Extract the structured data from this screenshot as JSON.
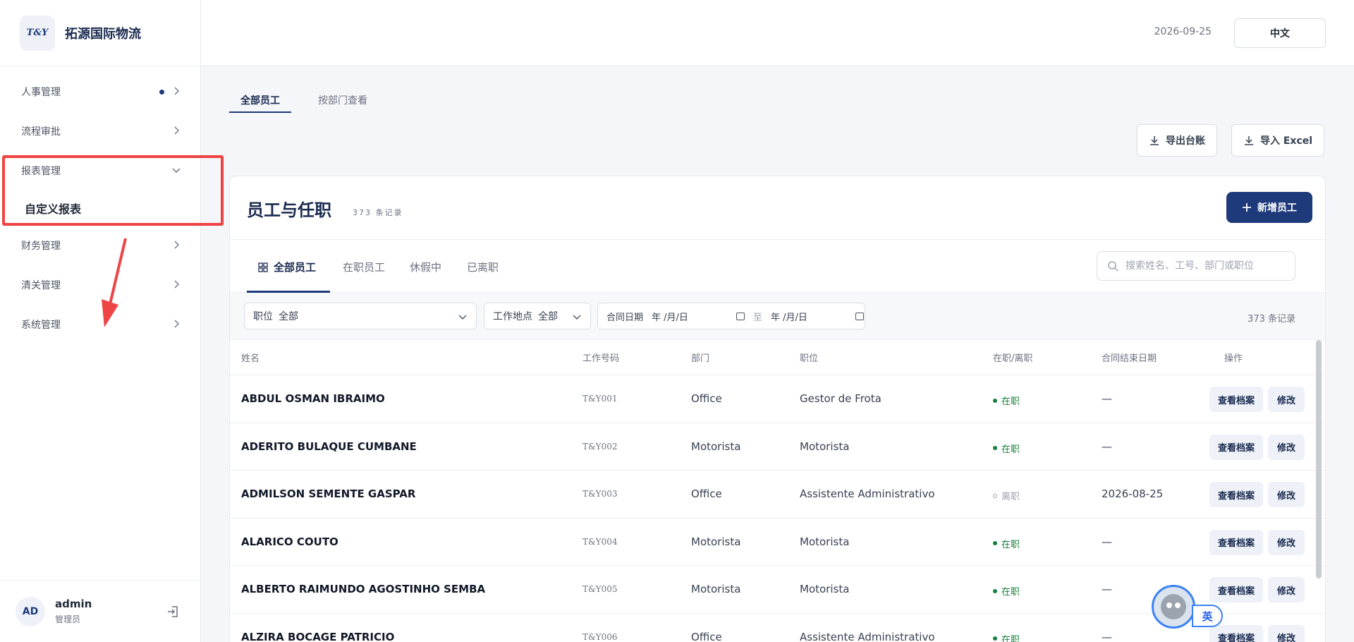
{
  "brand": {
    "logo_text": "T&Y",
    "name": "拓源国际物流"
  },
  "sidebar": {
    "items": [
      {
        "label": "人事管理",
        "has_dot": true,
        "expanded": false
      },
      {
        "label": "流程审批",
        "has_dot": false,
        "expanded": false
      },
      {
        "label": "报表管理",
        "has_dot": false,
        "expanded": true,
        "children": [
          {
            "label": "自定义报表"
          }
        ]
      },
      {
        "label": "财务管理",
        "has_dot": false,
        "expanded": false
      },
      {
        "label": "清关管理",
        "has_dot": false,
        "expanded": false
      },
      {
        "label": "系统管理",
        "has_dot": false,
        "expanded": false
      }
    ],
    "annotation_color": "#ef4444"
  },
  "user": {
    "initials": "AD",
    "name": "admin",
    "role": "管理员"
  },
  "topbar": {
    "date": "2026-09-25",
    "lang_label": "中文"
  },
  "top_tabs": [
    {
      "label": "全部员工",
      "active": true
    },
    {
      "label": "按部门查看",
      "active": false
    }
  ],
  "actions": {
    "export_label": "导出台账",
    "import_label": "导入 Excel"
  },
  "card": {
    "title": "员工与任职",
    "count": "373 条记录",
    "new_button": "新增员工",
    "sub_tabs": [
      {
        "label": "全部员工",
        "active": true
      },
      {
        "label": "在职员工",
        "active": false
      },
      {
        "label": "休假中",
        "active": false
      },
      {
        "label": "已离职",
        "active": false
      }
    ],
    "search_placeholder": "搜索姓名、工号、部门或职位"
  },
  "filters": {
    "position_label": "职位",
    "position_value": "全部",
    "location_label": "工作地点",
    "location_value": "全部",
    "contract_label": "合同日期",
    "date_placeholder": "年 /月/日",
    "range_sep": "至",
    "record_count": "373 条记录"
  },
  "table": {
    "headers": {
      "name": "姓名",
      "code": "工作号码",
      "dept": "部门",
      "position": "职位",
      "status": "在职/离职",
      "end_date": "合同结束日期",
      "ops": "操作"
    },
    "view_label": "查看档案",
    "edit_label": "修改",
    "rows": [
      {
        "name": "ABDUL OSMAN IBRAIMO",
        "code": "T&Y001",
        "dept": "Office",
        "position": "Gestor de Frota",
        "status": "在职",
        "active": true,
        "end_date": "—"
      },
      {
        "name": "ADERITO BULAQUE CUMBANE",
        "code": "T&Y002",
        "dept": "Motorista",
        "position": "Motorista",
        "status": "在职",
        "active": true,
        "end_date": "—"
      },
      {
        "name": "ADMILSON SEMENTE GASPAR",
        "code": "T&Y003",
        "dept": "Office",
        "position": "Assistente Administrativo",
        "status": "离职",
        "active": false,
        "end_date": "2026-08-25"
      },
      {
        "name": "ALARICO COUTO",
        "code": "T&Y004",
        "dept": "Motorista",
        "position": "Motorista",
        "status": "在职",
        "active": true,
        "end_date": "—"
      },
      {
        "name": "ALBERTO RAIMUNDO AGOSTINHO SEMBA",
        "code": "T&Y005",
        "dept": "Motorista",
        "position": "Motorista",
        "status": "在职",
        "active": true,
        "end_date": "—"
      },
      {
        "name": "ALZIRA BOCAGE PATRICIO",
        "code": "T&Y006",
        "dept": "Office",
        "position": "Assistente Administrativo",
        "status": "在职",
        "active": true,
        "end_date": "—"
      }
    ]
  },
  "assistant": {
    "lang_label": "英"
  }
}
